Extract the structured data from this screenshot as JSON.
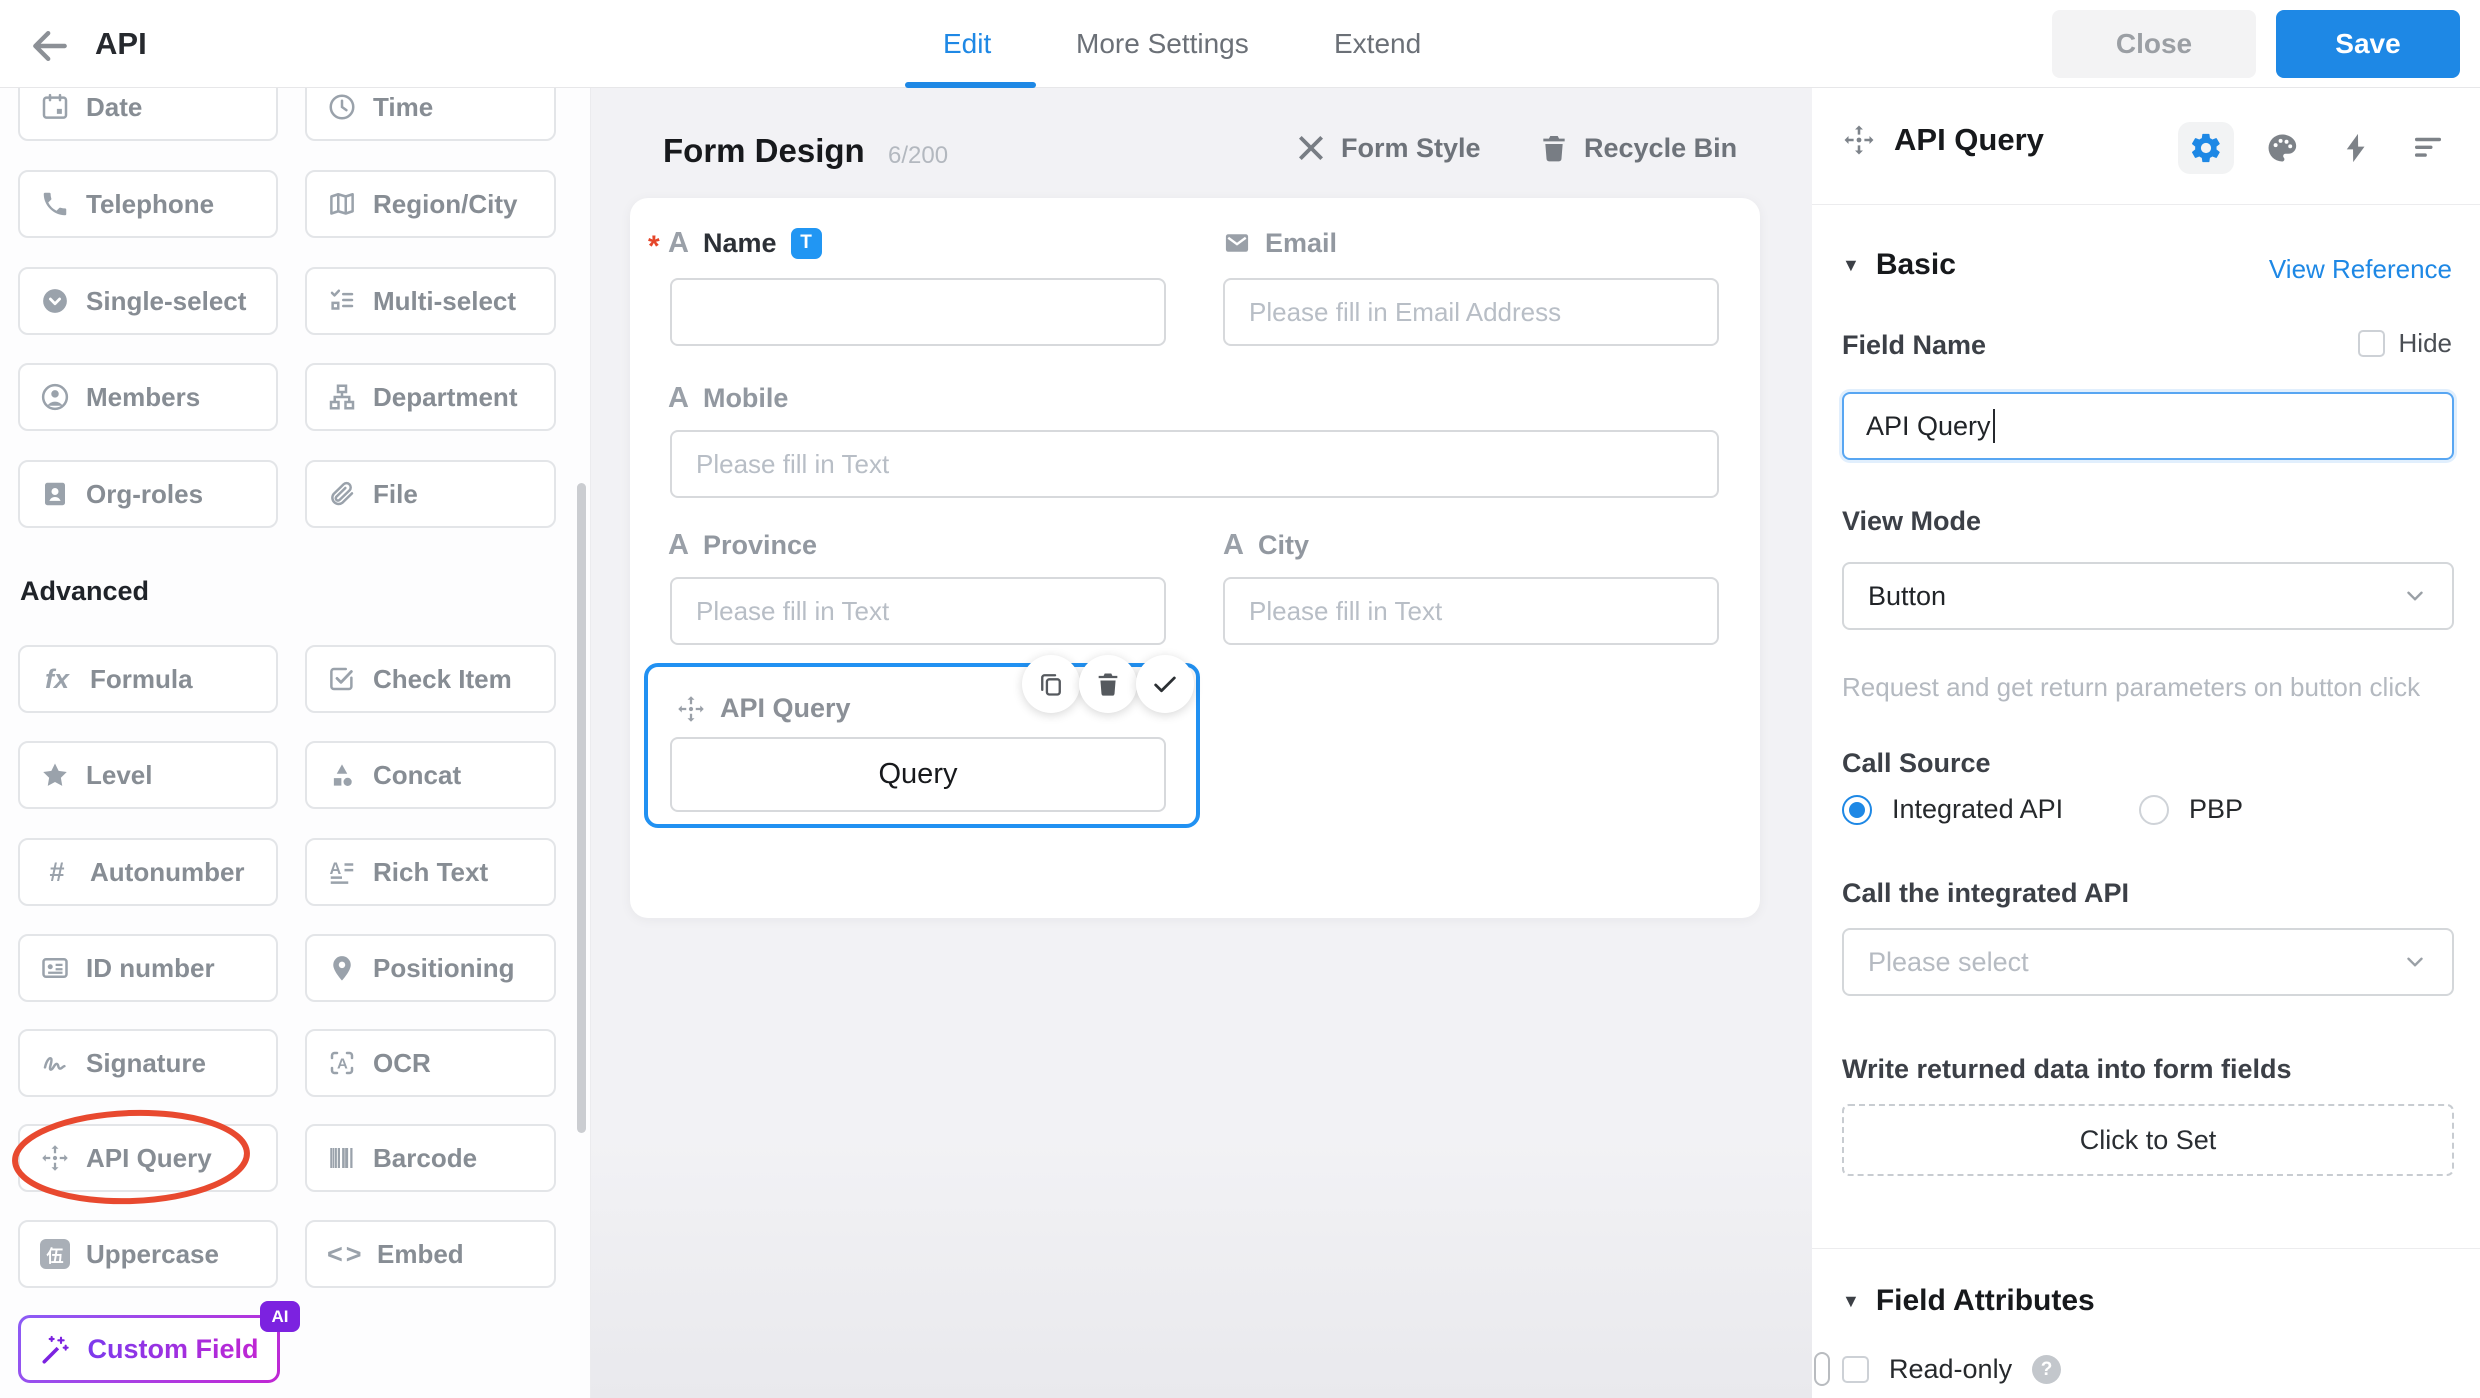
{
  "topbar": {
    "title": "API",
    "tabs": [
      {
        "label": "Edit",
        "active": true
      },
      {
        "label": "More Settings",
        "active": false
      },
      {
        "label": "Extend",
        "active": false
      }
    ],
    "close_label": "Close",
    "save_label": "Save"
  },
  "sidebar": {
    "basic_items": [
      {
        "label": "Date",
        "icon": "calendar-icon"
      },
      {
        "label": "Time",
        "icon": "clock-icon"
      },
      {
        "label": "Telephone",
        "icon": "phone-icon"
      },
      {
        "label": "Region/City",
        "icon": "map-icon"
      },
      {
        "label": "Single-select",
        "icon": "single-select-icon"
      },
      {
        "label": "Multi-select",
        "icon": "multi-select-icon"
      },
      {
        "label": "Members",
        "icon": "person-icon"
      },
      {
        "label": "Department",
        "icon": "org-tree-icon"
      },
      {
        "label": "Org-roles",
        "icon": "id-badge-icon"
      },
      {
        "label": "File",
        "icon": "paperclip-icon"
      }
    ],
    "advanced_title": "Advanced",
    "advanced_items": [
      {
        "label": "Formula",
        "icon": "fx-icon"
      },
      {
        "label": "Check Item",
        "icon": "check-square-icon"
      },
      {
        "label": "Level",
        "icon": "star-icon"
      },
      {
        "label": "Concat",
        "icon": "shapes-icon"
      },
      {
        "label": "Autonumber",
        "icon": "hash-icon"
      },
      {
        "label": "Rich Text",
        "icon": "rich-text-icon"
      },
      {
        "label": "ID number",
        "icon": "id-card-icon"
      },
      {
        "label": "Positioning",
        "icon": "pin-icon"
      },
      {
        "label": "Signature",
        "icon": "signature-icon"
      },
      {
        "label": "OCR",
        "icon": "ocr-icon"
      },
      {
        "label": "API Query",
        "icon": "move-icon",
        "annotated": "red-ellipse"
      },
      {
        "label": "Barcode",
        "icon": "barcode-icon"
      },
      {
        "label": "Uppercase",
        "icon": "uppercase-icon",
        "icon_glyph": "伍"
      },
      {
        "label": "Embed",
        "icon": "embed-icon",
        "icon_glyph": "<>"
      }
    ],
    "custom_field": {
      "label": "Custom Field",
      "badge": "AI",
      "icon": "wand-icon"
    }
  },
  "canvas": {
    "title": "Form Design",
    "count": "6/200",
    "form_style_label": "Form Style",
    "recycle_bin_label": "Recycle Bin",
    "fields": {
      "name": {
        "label": "Name",
        "required": "*",
        "badge": "T",
        "value": ""
      },
      "email": {
        "label": "Email",
        "placeholder": "Please fill in Email Address"
      },
      "mobile": {
        "label": "Mobile",
        "placeholder": "Please fill in Text"
      },
      "province": {
        "label": "Province",
        "placeholder": "Please fill in Text"
      },
      "city": {
        "label": "City",
        "placeholder": "Please fill in Text"
      },
      "api_query": {
        "label": "API Query",
        "button_label": "Query"
      }
    }
  },
  "panel": {
    "title": "API Query",
    "basic_section": {
      "title": "Basic",
      "link": "View Reference"
    },
    "field_name": {
      "label": "Field Name",
      "value": "API Query",
      "hide_label": "Hide",
      "hide_checked": false
    },
    "view_mode": {
      "label": "View Mode",
      "value": "Button",
      "helper": "Request and get return parameters on button click"
    },
    "call_source": {
      "label": "Call Source",
      "options": [
        {
          "label": "Integrated API",
          "selected": true
        },
        {
          "label": "PBP",
          "selected": false
        }
      ]
    },
    "integrated_api": {
      "label": "Call the integrated API",
      "placeholder": "Please select"
    },
    "write_back": {
      "label": "Write returned data into form fields",
      "button_label": "Click to Set"
    },
    "field_attributes_section": {
      "title": "Field Attributes"
    },
    "read_only": {
      "label": "Read-only",
      "checked": false
    }
  },
  "colors": {
    "accent_blue": "#1E88E5",
    "selection_blue": "#2191F2",
    "badge_blue": "#2196F3",
    "purple": "#7C22E0",
    "annotation_red": "#E8492F",
    "required_red": "#E5462A"
  }
}
